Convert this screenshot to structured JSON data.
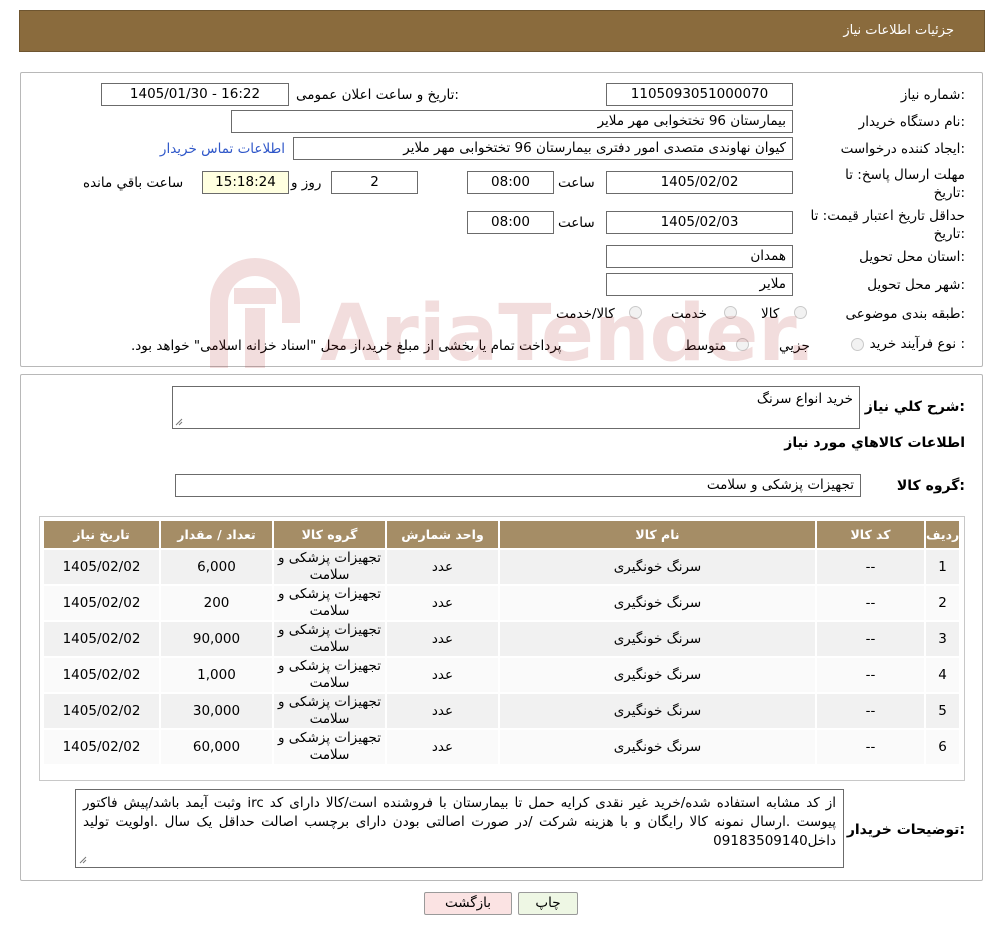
{
  "header": {
    "title": "جزئیات اطلاعات نیاز"
  },
  "form": {
    "need_number_label": "شماره نیاز:",
    "need_number": "1105093051000070",
    "announce_label": "تاریخ و ساعت اعلان عمومی:",
    "announce_value": "1405/01/30 - 16:22",
    "buyer_org_label": "نام دستگاه خریدار:",
    "buyer_org": "بیمارستان 96 تختخوابی مهر ملایر",
    "requester_label": "ایجاد کننده درخواست:",
    "requester": "کیوان نهاوندی متصدی امور دفتری بیمارستان 96 تختخوابی مهر ملایر",
    "buyer_contact_link": "اطلاعات تماس خریدار",
    "reply_deadline_label": "مهلت ارسال پاسخ: تا تاریخ:",
    "reply_date": "1405/02/02",
    "time_label": "ساعت",
    "reply_time": "08:00",
    "days_value": "2",
    "days_label": "روز و",
    "remaining_time": "15:18:24",
    "remaining_label": "ساعت باقي مانده",
    "price_validity_label": "حداقل تاریخ اعتبار قیمت: تا تاریخ:",
    "price_date": "1405/02/03",
    "price_time": "08:00",
    "province_label": "استان محل تحویل:",
    "province": "همدان",
    "city_label": "شهر محل تحویل:",
    "city": "ملایر",
    "category_label": "طبقه بندی موضوعی:",
    "category_options": [
      "کالا",
      "خدمت",
      "کالا/خدمت"
    ],
    "process_label": "نوع فرآیند خرید :",
    "process_options": [
      "جزیي",
      "متوسط"
    ],
    "process_note": "پرداخت تمام یا بخشی از مبلغ خرید،از محل \"اسناد خزانه اسلامی\" خواهد بود."
  },
  "details": {
    "summary_label": "شرح کلي نیاز:",
    "summary": "خرید انواع سرنگ",
    "goods_info_title": "اطلاعات کالاهاي مورد نیاز",
    "goods_group_label": "گروه کالا:",
    "goods_group": "تجهیزات پزشکی و سلامت"
  },
  "table": {
    "headers": [
      "ردیف",
      "کد کالا",
      "نام کالا",
      "واحد شمارش",
      "گروه کالا",
      "تعداد / مقدار",
      "تاریخ نیاز"
    ],
    "rows": [
      [
        "1",
        "--",
        "سرنگ خونگیری",
        "عدد",
        "تجهیزات پزشکی و سلامت",
        "6,000",
        "1405/02/02"
      ],
      [
        "2",
        "--",
        "سرنگ خونگیری",
        "عدد",
        "تجهیزات پزشکی و سلامت",
        "200",
        "1405/02/02"
      ],
      [
        "3",
        "--",
        "سرنگ خونگیری",
        "عدد",
        "تجهیزات پزشکی و سلامت",
        "90,000",
        "1405/02/02"
      ],
      [
        "4",
        "--",
        "سرنگ خونگیری",
        "عدد",
        "تجهیزات پزشکی و سلامت",
        "1,000",
        "1405/02/02"
      ],
      [
        "5",
        "--",
        "سرنگ خونگیری",
        "عدد",
        "تجهیزات پزشکی و سلامت",
        "30,000",
        "1405/02/02"
      ],
      [
        "6",
        "--",
        "سرنگ خونگیری",
        "عدد",
        "تجهیزات پزشکی و سلامت",
        "60,000",
        "1405/02/02"
      ]
    ]
  },
  "notes": {
    "label": "توضیحات خریدار:",
    "text": "از کد مشابه استفاده شده/خرید غیر نقدی کرایه حمل تا بیمارستان با فروشنده است/کالا دارای کد irc  وثبت آیمد باشد/پیش فاکتور پیوست .ارسال نمونه کالا رایگان و با هزینه شرکت /در صورت اصالتی بودن دارای برچسب اصالت حداقل یک سال .اولویت تولید داخل09183509140"
  },
  "buttons": {
    "print": "چاپ",
    "back": "بازگشت"
  },
  "watermark": {
    "text": "AriaTender.neT"
  },
  "colors": {
    "header_bg": "#8a6b3d",
    "table_header_bg": "#a58d66",
    "link": "#2f57c9"
  }
}
